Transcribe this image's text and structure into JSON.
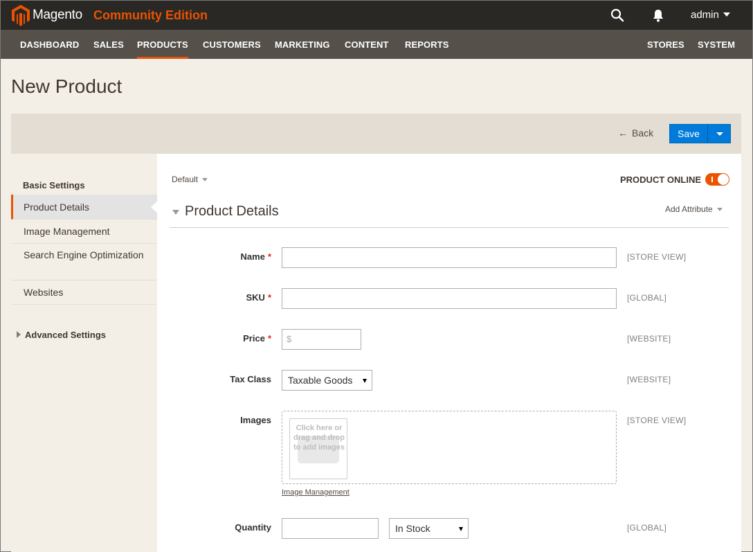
{
  "header": {
    "brand": "Magento",
    "edition": "Community Edition",
    "user": "admin",
    "brand_color": "#eb5202"
  },
  "nav": {
    "items": [
      "DASHBOARD",
      "SALES",
      "PRODUCTS",
      "CUSTOMERS",
      "MARKETING",
      "CONTENT",
      "REPORTS",
      "STORES",
      "SYSTEM"
    ],
    "active": "PRODUCTS"
  },
  "page": {
    "title": "New Product"
  },
  "actions": {
    "back": "Back",
    "save": "Save"
  },
  "sidebar": {
    "basic_heading": "Basic Settings",
    "items": [
      "Product Details",
      "Image Management",
      "Search Engine Optimization",
      "Websites"
    ],
    "active": "Product Details",
    "advanced": "Advanced Settings"
  },
  "main": {
    "scope_switcher": "Default",
    "product_online_label": "PRODUCT ONLINE",
    "product_online": true,
    "section_title": "Product Details",
    "add_attribute": "Add Attribute"
  },
  "fields": {
    "name": {
      "label": "Name",
      "required": "*",
      "value": "",
      "scope": "[STORE VIEW]"
    },
    "sku": {
      "label": "SKU",
      "required": "*",
      "value": "",
      "scope": "[GLOBAL]"
    },
    "price": {
      "label": "Price",
      "required": "*",
      "prefix": "$",
      "value": "",
      "scope": "[WEBSITE]"
    },
    "tax_class": {
      "label": "Tax Class",
      "value": "Taxable Goods",
      "scope": "[WEBSITE]"
    },
    "images": {
      "label": "Images",
      "upload_text": "Click here or drag and drop to add images",
      "link": "Image Management",
      "scope": "[STORE VIEW]"
    },
    "quantity": {
      "label": "Quantity",
      "value": "",
      "stock_status": "In Stock",
      "scope": "[GLOBAL]"
    }
  }
}
